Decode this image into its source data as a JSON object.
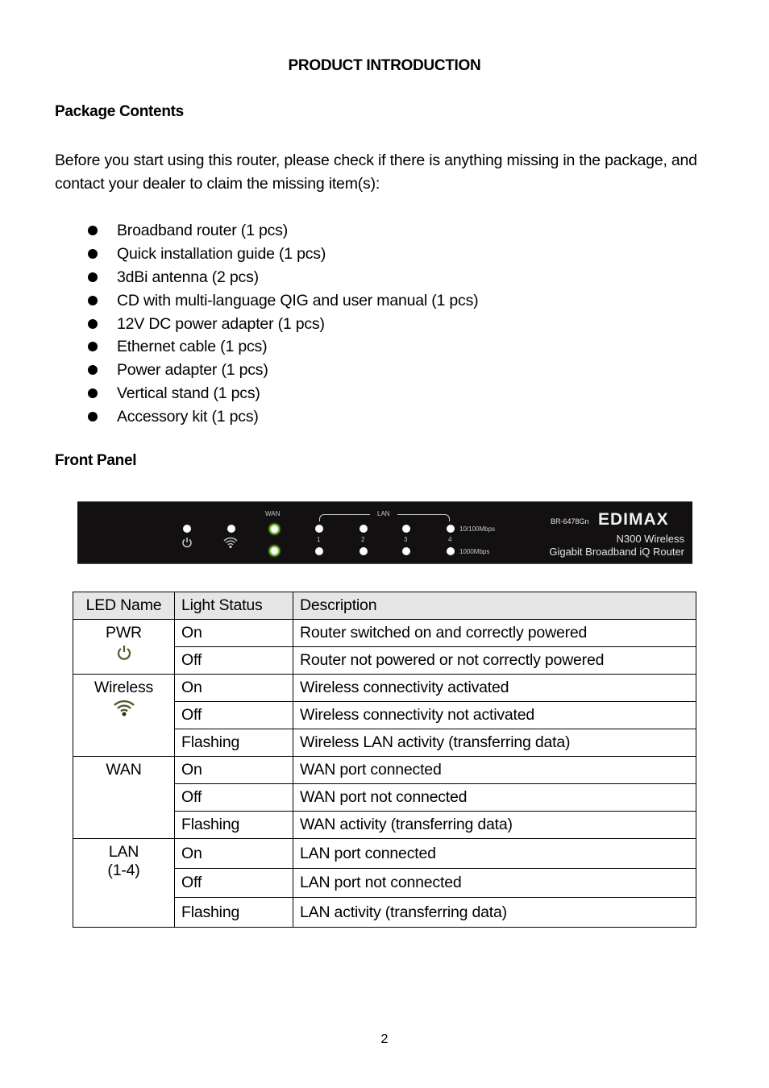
{
  "page": {
    "title": "PRODUCT INTRODUCTION",
    "page_number": "2"
  },
  "package_contents": {
    "heading": "Package Contents",
    "intro": "Before you start using this router, please check if there is anything missing in the package, and contact your dealer to claim the missing item(s):",
    "items": [
      "Broadband router (1 pcs)",
      "Quick installation guide (1 pcs)",
      "3dBi antenna (2 pcs)",
      "CD with multi-language QIG and user manual (1 pcs)",
      "12V DC power adapter (1 pcs)",
      "Ethernet cable (1 pcs)",
      "Power adapter (1 pcs)",
      "Vertical stand (1 pcs)",
      "Accessory kit (1 pcs)"
    ]
  },
  "front_panel": {
    "heading": "Front Panel",
    "image": {
      "wan_label": "WAN",
      "lan_label": "LAN",
      "port_numbers": [
        "1",
        "2",
        "3",
        "4"
      ],
      "speed_10_100": "10/100Mbps",
      "speed_1000": "1000Mbps",
      "model": "BR-6478Gn",
      "brand": "EDIMAX",
      "product_line1": "N300 Wireless",
      "product_line2": "Gigabit Broadband iQ Router",
      "led_green": "#7ac142"
    }
  },
  "led_table": {
    "headers": [
      "LED Name",
      "Light Status",
      "Description"
    ],
    "icon_color": "#4b5a2c",
    "groups": [
      {
        "name": "PWR",
        "icon": "power-icon",
        "rows": [
          {
            "status": "On",
            "description": "Router switched on and correctly powered"
          },
          {
            "status": "Off",
            "description": "Router not powered or not correctly powered"
          }
        ]
      },
      {
        "name": "Wireless",
        "icon": "wifi-icon",
        "rows": [
          {
            "status": "On",
            "description": "Wireless connectivity activated"
          },
          {
            "status": "Off",
            "description": "Wireless connectivity not activated"
          },
          {
            "status": "Flashing",
            "description": "Wireless LAN activity (transferring data)"
          }
        ]
      },
      {
        "name": "WAN",
        "rows": [
          {
            "status": "On",
            "description": "WAN port connected"
          },
          {
            "status": "Off",
            "description": "WAN port not connected"
          },
          {
            "status": "Flashing",
            "description": "WAN activity (transferring data)"
          }
        ]
      },
      {
        "name": "LAN",
        "subname": "(1-4)",
        "rows": [
          {
            "status": "On",
            "description": "LAN port connected"
          },
          {
            "status": "Off",
            "description": "LAN port not connected"
          },
          {
            "status": "Flashing",
            "description": "LAN activity (transferring data)"
          }
        ]
      }
    ]
  }
}
